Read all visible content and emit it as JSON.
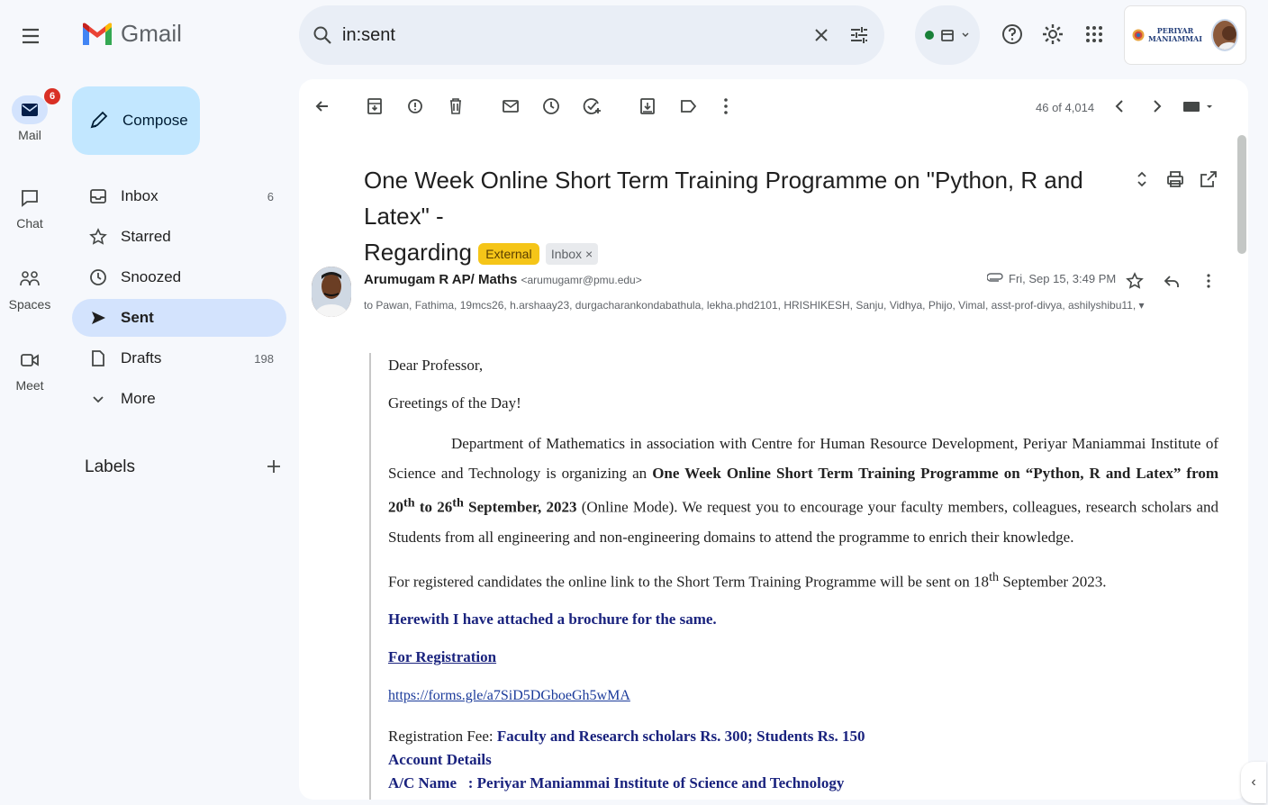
{
  "app": {
    "name": "Gmail"
  },
  "search": {
    "query": "in:sent"
  },
  "rail": {
    "mail": "Mail",
    "mail_badge": "6",
    "chat": "Chat",
    "spaces": "Spaces",
    "meet": "Meet"
  },
  "compose_label": "Compose",
  "nav": [
    {
      "label": "Inbox",
      "count": "6"
    },
    {
      "label": "Starred",
      "count": ""
    },
    {
      "label": "Snoozed",
      "count": ""
    },
    {
      "label": "Sent",
      "count": ""
    },
    {
      "label": "Drafts",
      "count": "198"
    },
    {
      "label": "More",
      "count": ""
    }
  ],
  "labels_heading": "Labels",
  "org_logo_text": "PERIYAR MANIAMMAI",
  "pager": "46 of 4,014",
  "email": {
    "subject_line1": "One Week Online Short Term Training Programme on \"Python, R and Latex\" -",
    "subject_line2": "Regarding",
    "tag_external": "External",
    "tag_inbox": "Inbox ×",
    "sender_name": "Arumugam R AP/ Maths",
    "sender_email": "<arumugamr@pmu.edu>",
    "recipients": "to Pawan, Fathima, 19mcs26, h.arshaay23, durgacharankondabathula, lekha.phd2101, HRISHIKESH, Sanju, Vidhya, Phijo, Vimal, asst-prof-divya, ashilyshibu11,",
    "date": "Fri, Sep 15, 3:49 PM",
    "greeting": "Dear Professor,",
    "greeting2": "Greetings of the Day!",
    "para1_a": "Department of Mathematics  in association with Centre for Human Resource Development, Periyar Maniammai Institute of Science and Technology is organizing an ",
    "para1_b": "One Week Online Short Term Training Programme on “Python, R and Latex” from 20",
    "para1_sup1": "th",
    "para1_c": " to 26",
    "para1_sup2": "th",
    "para1_d": " September, 2023",
    "para1_e": " (Online Mode). We request you to encourage your faculty members, colleagues, research scholars and Students from all engineering and non-engineering domains to attend the programme to enrich their knowledge.",
    "para2_a": "For registered candidates the online link to the Short Term Training Programme will be sent on 18",
    "para2_sup": "th",
    "para2_b": " September 2023.",
    "attached": "Herewith I have attached a brochure for the same.",
    "registration": "For Registration",
    "reg_link": "https://forms.gle/a7SiD5DGboeGh5wMA",
    "fee_label": "Registration Fee: ",
    "fee_value": "Faculty and Research scholars Rs. 300; Students Rs. 150",
    "account_details": "Account Details",
    "ac_name_label": "A/C Name",
    "ac_name_value": ": Periyar Maniammai Institute of Science and Technology"
  }
}
